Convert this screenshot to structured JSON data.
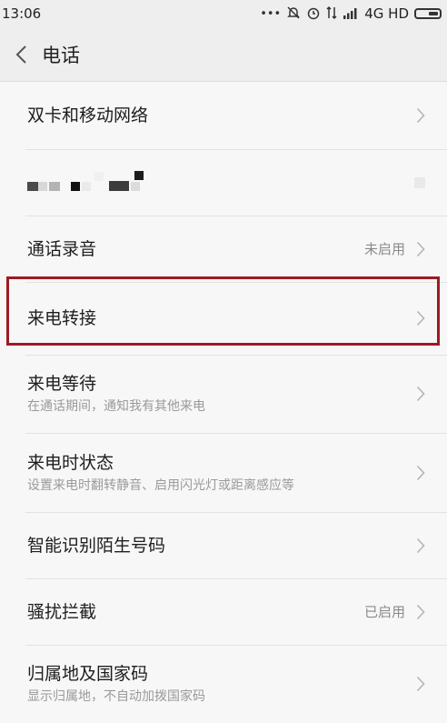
{
  "status_bar": {
    "time": "13:06",
    "network": "4G HD",
    "icons": [
      "more-dots-icon",
      "mute-bell-icon",
      "alarm-icon",
      "data-arrows-icon",
      "signal-icon",
      "battery-icon"
    ]
  },
  "header": {
    "back_icon": "chevron-left-icon",
    "title": "电话"
  },
  "rows": [
    {
      "title": "双卡和移动网络",
      "subtitle": "",
      "value": ""
    },
    {
      "title": "",
      "subtitle": "",
      "value": "",
      "redacted": true
    },
    {
      "title": "通话录音",
      "subtitle": "",
      "value": "未启用"
    },
    {
      "title": "来电转接",
      "subtitle": "",
      "value": "",
      "highlighted": true
    },
    {
      "title": "来电等待",
      "subtitle": "在通话期间，通知我有其他来电",
      "value": ""
    },
    {
      "title": "来电时状态",
      "subtitle": "设置来电时翻转静音、启用闪光灯或距离感应等",
      "value": ""
    },
    {
      "title": "智能识别陌生号码",
      "subtitle": "",
      "value": ""
    },
    {
      "title": "骚扰拦截",
      "subtitle": "",
      "value": "已启用"
    },
    {
      "title": "归属地及国家码",
      "subtitle": "显示归属地，不自动加拨国家码",
      "value": ""
    }
  ],
  "colors": {
    "highlight_border": "#9c1b22",
    "background": "#f7f7f7",
    "bar_background": "#eeeeee"
  }
}
